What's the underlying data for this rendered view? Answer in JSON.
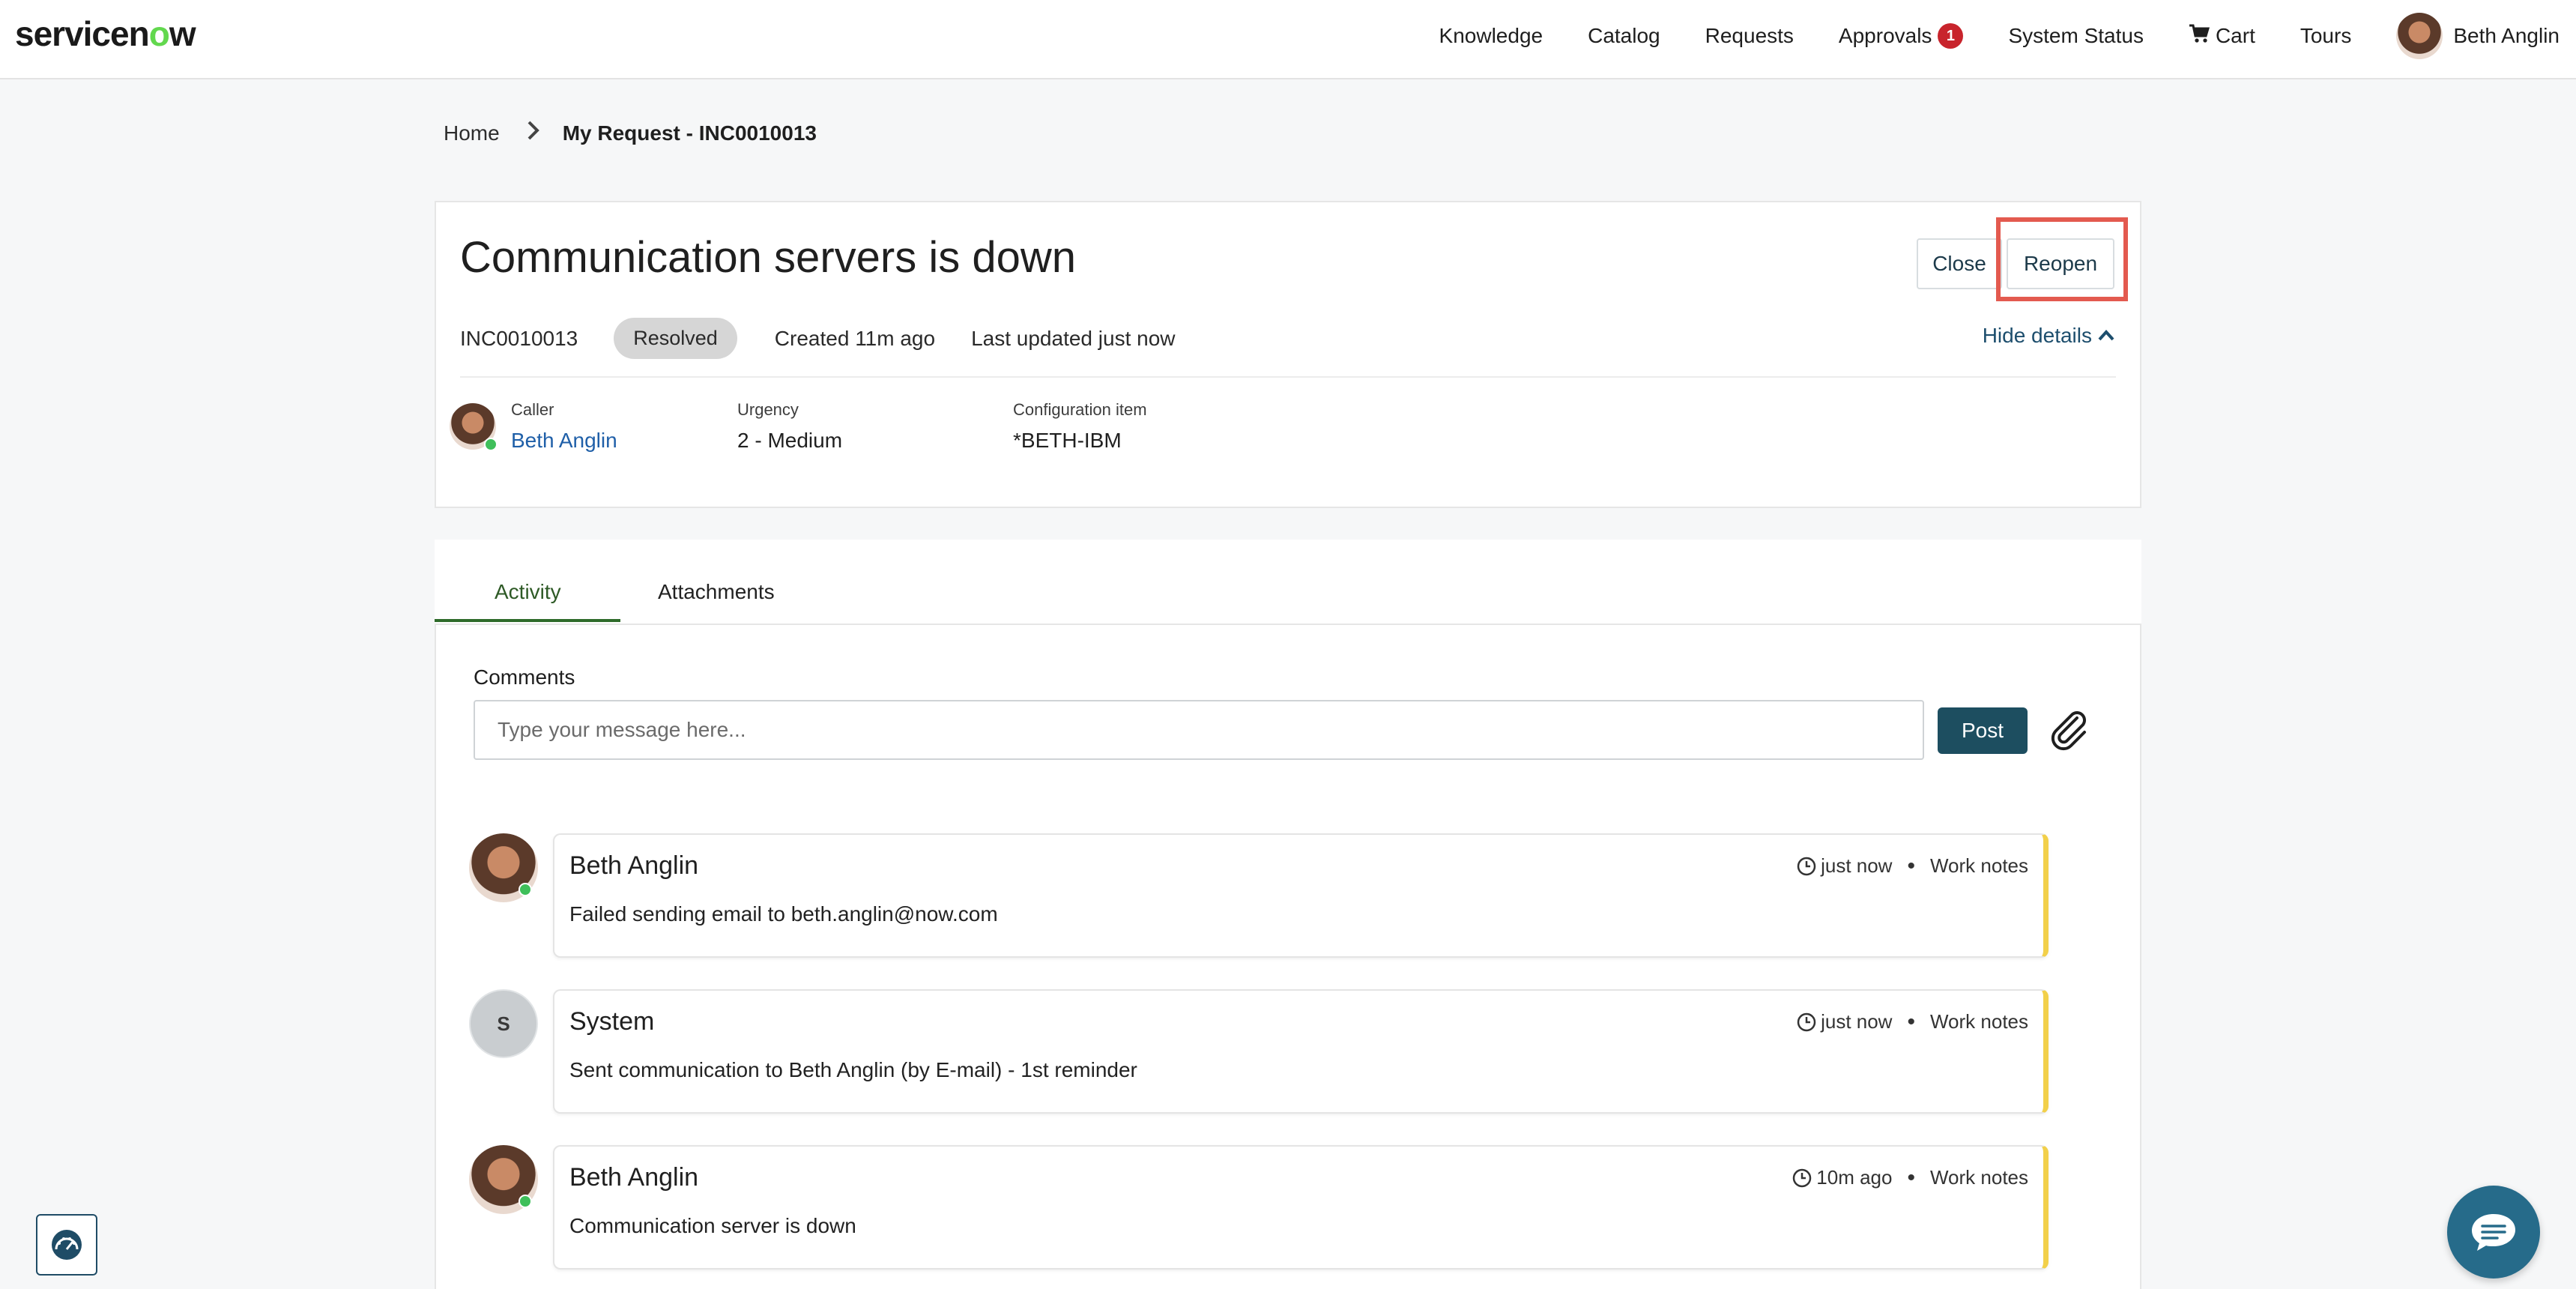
{
  "brand": {
    "logo_text_pre": "servicen",
    "logo_text_o": "o",
    "logo_text_post": "w"
  },
  "nav": {
    "knowledge": "Knowledge",
    "catalog": "Catalog",
    "requests": "Requests",
    "approvals": "Approvals",
    "approvals_count": "1",
    "system_status": "System Status",
    "cart": "Cart",
    "tours": "Tours",
    "user_name": "Beth Anglin"
  },
  "breadcrumb": {
    "home": "Home",
    "current": "My Request - INC0010013"
  },
  "ticket": {
    "title": "Communication servers is down",
    "number": "INC0010013",
    "state": "Resolved",
    "created": "Created 11m ago",
    "updated": "Last updated just now",
    "hide_details": "Hide details",
    "close_label": "Close",
    "reopen_label": "Reopen",
    "fields": {
      "caller_label": "Caller",
      "caller_value": "Beth Anglin",
      "urgency_label": "Urgency",
      "urgency_value": "2 - Medium",
      "ci_label": "Configuration item",
      "ci_value": "*BETH-IBM"
    }
  },
  "tabs": {
    "activity": "Activity",
    "attachments": "Attachments"
  },
  "comments": {
    "label": "Comments",
    "placeholder": "Type your message here...",
    "post_label": "Post"
  },
  "activity": [
    {
      "author": "Beth Anglin",
      "time": "just now",
      "type": "Work notes",
      "text": "Failed sending email to beth.anglin@now.com"
    },
    {
      "author": "System",
      "initial": "S",
      "time": "just now",
      "type": "Work notes",
      "text": "Sent communication to Beth Anglin (by E-mail) - 1st reminder"
    },
    {
      "author": "Beth Anglin",
      "time": "10m ago",
      "type": "Work notes",
      "text": "Communication server is down"
    }
  ],
  "colors": {
    "accent_green": "#62d84e",
    "badge_red": "#c8242c",
    "post_button": "#1d4e60",
    "highlight": "#e35a4f",
    "worknote_bar": "#f2d04a"
  }
}
